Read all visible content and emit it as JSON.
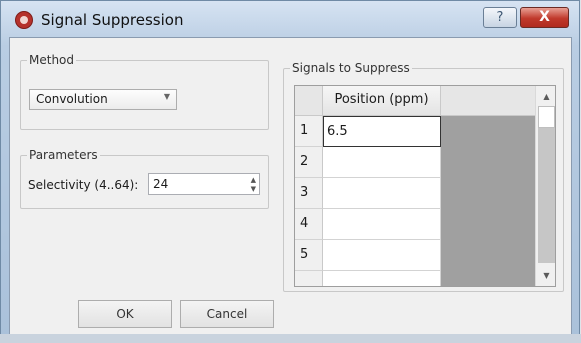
{
  "window": {
    "title": "Signal Suppression",
    "help_glyph": "?",
    "close_glyph": "X"
  },
  "method": {
    "legend": "Method",
    "selected": "Convolution",
    "arrow": "▼"
  },
  "parameters": {
    "legend": "Parameters",
    "selectivity_label": "Selectivity (4..64):",
    "selectivity_value": "24",
    "spin_up": "▲",
    "spin_down": "▼"
  },
  "signals": {
    "legend": "Signals to Suppress",
    "column_header": "Position (ppm)",
    "rows": [
      {
        "index": "1",
        "value": "6.5"
      },
      {
        "index": "2",
        "value": ""
      },
      {
        "index": "3",
        "value": ""
      },
      {
        "index": "4",
        "value": ""
      },
      {
        "index": "5",
        "value": ""
      },
      {
        "index": "",
        "value": ""
      }
    ],
    "scroll_up": "▲",
    "scroll_down": "▼"
  },
  "buttons": {
    "ok": "OK",
    "cancel": "Cancel"
  }
}
